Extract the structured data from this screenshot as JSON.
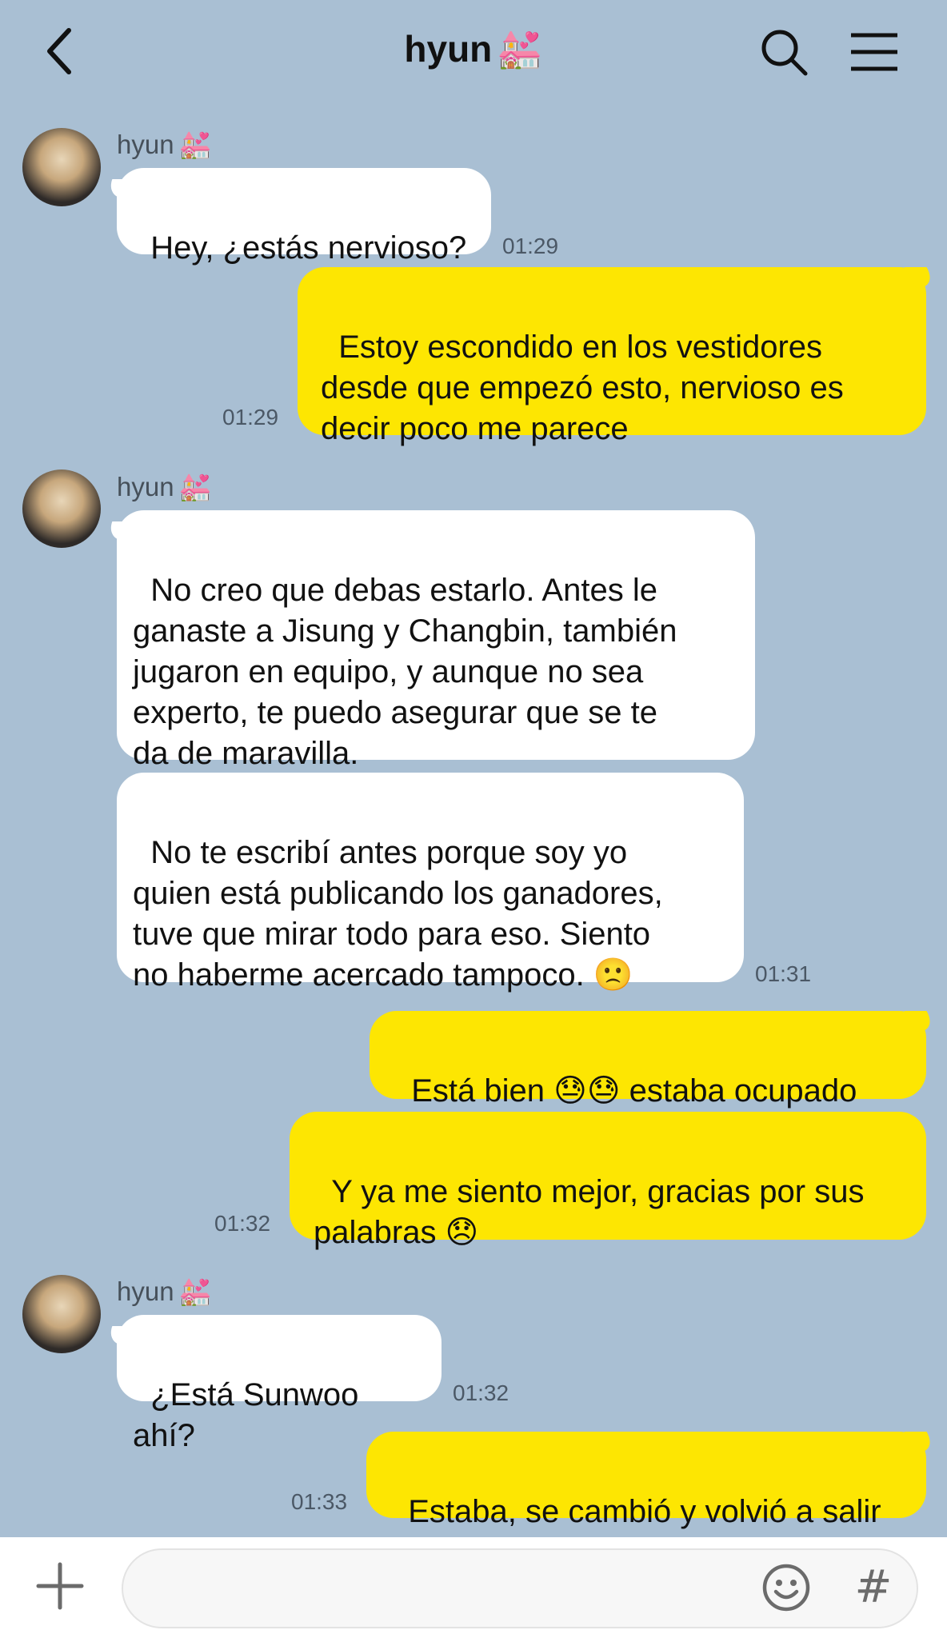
{
  "header": {
    "title": "hyun",
    "title_emoji": "💒"
  },
  "messages": [
    {
      "sender": "hyun",
      "sender_emoji": "💒",
      "text": "Hey, ¿estás nervioso?",
      "time": "01:29"
    },
    {
      "text": "Estoy escondido en los vestidores\ndesde que empezó esto, nervioso es\ndecir poco me parece",
      "time": "01:29"
    },
    {
      "sender": "hyun",
      "sender_emoji": "💒",
      "text": "No creo que debas estarlo. Antes le\nganaste a Jisung y Changbin, también\njugaron en equipo, y aunque no sea\nexperto, te puedo asegurar que se te\nda de maravilla."
    },
    {
      "text": "No te escribí antes porque soy yo\nquien está publicando los ganadores,\ntuve que mirar todo para eso. Siento\nno haberme acercado tampoco. 🙁",
      "time": "01:31"
    },
    {
      "text": "Está bien 😓😓 estaba ocupado"
    },
    {
      "text": "Y ya me siento mejor, gracias por sus\npalabras 😞",
      "time": "01:32"
    },
    {
      "sender": "hyun",
      "sender_emoji": "💒",
      "text": "¿Está Sunwoo ahí?",
      "time": "01:32"
    },
    {
      "text": "Estaba, se cambió y volvió a salir",
      "time": "01:33"
    }
  ],
  "footer": {
    "input_placeholder": "",
    "hash_label": "#"
  },
  "colors": {
    "background": "#a9bfd3",
    "outgoing_bubble": "#fde602",
    "incoming_bubble": "#ffffff"
  }
}
